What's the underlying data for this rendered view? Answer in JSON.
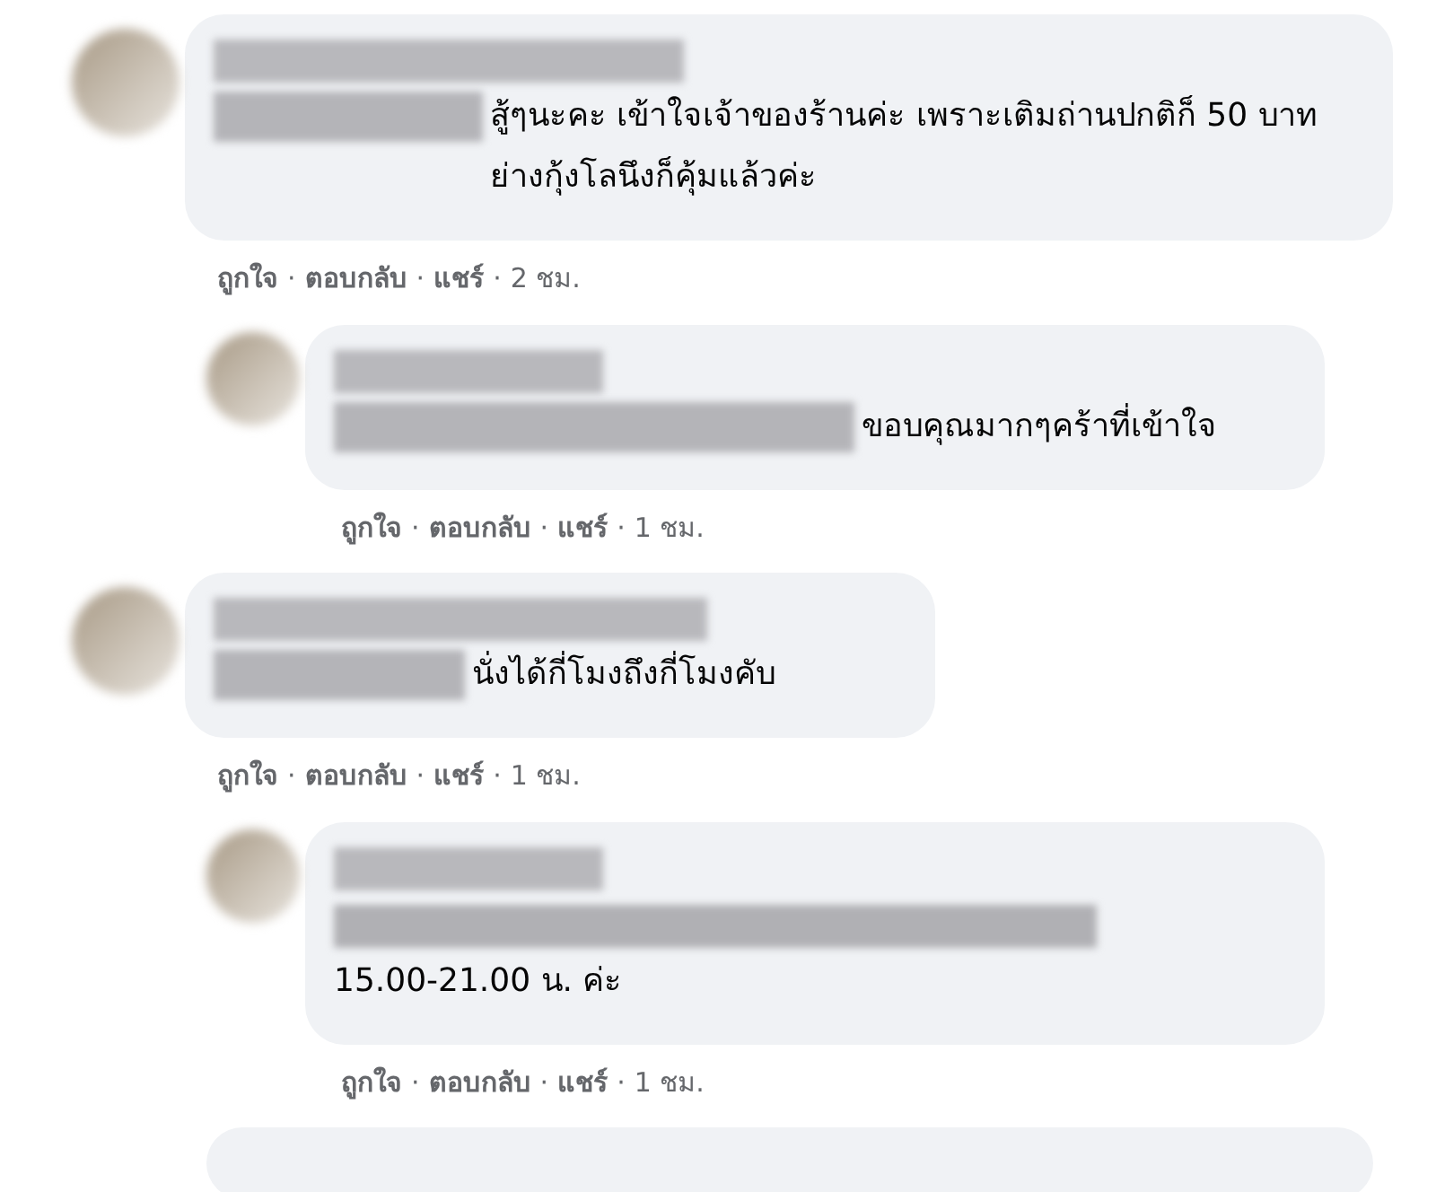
{
  "comments": [
    {
      "text": "สู้ๆนะคะ เข้าใจเจ้าของร้านค่ะ เพราะเติมถ่านปกติก็ 50 บาท ย่างกุ้งโลนึงก็คุ้มแล้วค่ะ",
      "actions": [
        "ถูกใจ",
        "ตอบกลับ",
        "แชร์"
      ],
      "separator": "·",
      "time": "2 ชม.",
      "replies": [
        {
          "text": "ขอบคุณมากๆคร้าที่เข้าใจ",
          "actions": [
            "ถูกใจ",
            "ตอบกลับ",
            "แชร์"
          ],
          "separator": "·",
          "time": "1 ชม."
        }
      ]
    },
    {
      "text": "นั่งได้กี่โมงถึงกี่โมงคับ",
      "actions": [
        "ถูกใจ",
        "ตอบกลับ",
        "แชร์"
      ],
      "separator": "·",
      "time": "1 ชม.",
      "replies": [
        {
          "text": "15.00-21.00 น. ค่ะ",
          "actions": [
            "ถูกใจ",
            "ตอบกลับ",
            "แชร์"
          ],
          "separator": "·",
          "time": "1 ชม."
        }
      ]
    }
  ],
  "more_below": true
}
